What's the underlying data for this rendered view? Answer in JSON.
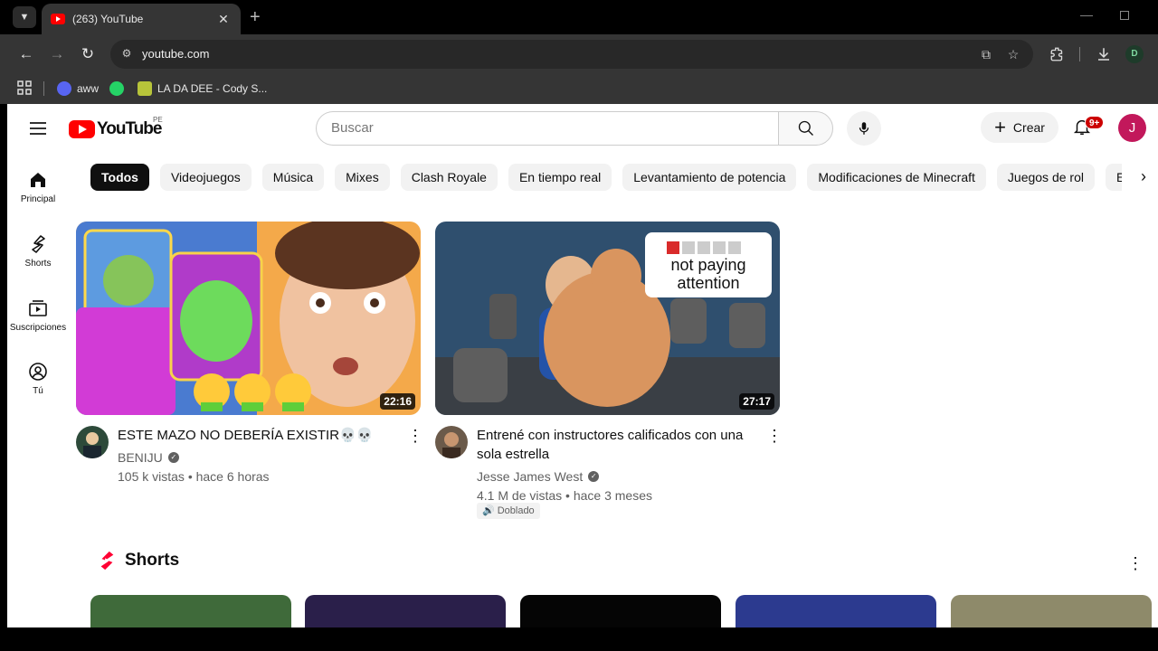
{
  "browser": {
    "tab_title": "(263) YouTube",
    "url": "youtube.com",
    "profile_initial": "D",
    "bookmarks": [
      {
        "label": "aww",
        "icon": "discord-icon"
      },
      {
        "label": "",
        "icon": "whatsapp-icon"
      },
      {
        "label": "LA DA DEE - Cody S...",
        "icon": "bookmark-icon"
      }
    ]
  },
  "header": {
    "logo_text": "YouTube",
    "country_code": "PE",
    "search_placeholder": "Buscar",
    "create_label": "Crear",
    "notification_count": "9+",
    "avatar_initial": "J"
  },
  "sidebar": {
    "items": [
      {
        "label": "Principal",
        "icon": "home-icon"
      },
      {
        "label": "Shorts",
        "icon": "shorts-icon"
      },
      {
        "label": "Suscripciones",
        "icon": "subscriptions-icon"
      },
      {
        "label": "Tú",
        "icon": "user-icon"
      }
    ]
  },
  "chips": [
    "Todos",
    "Videojuegos",
    "Música",
    "Mixes",
    "Clash Royale",
    "En tiempo real",
    "Levantamiento de potencia",
    "Modificaciones de Minecraft",
    "Juegos de rol",
    "Entrenamie"
  ],
  "videos": [
    {
      "title": "ESTE MAZO NO DEBERÍA EXISTIR💀💀",
      "channel": "BENIJU",
      "stats": "105 k vistas • hace 6 horas",
      "duration": "22:16"
    },
    {
      "title": "Entrené con instructores calificados con una sola estrella",
      "channel": "Jesse James West",
      "stats": "4.1 M de vistas • hace 3 meses",
      "duration": "27:17",
      "badge": "Doblado",
      "thumb_caption": "not paying attention"
    }
  ],
  "shorts": {
    "title": "Shorts"
  },
  "colors": {
    "brand_red": "#ff0000",
    "notification_red": "#cc0000",
    "avatar_pink": "#c2185b"
  }
}
